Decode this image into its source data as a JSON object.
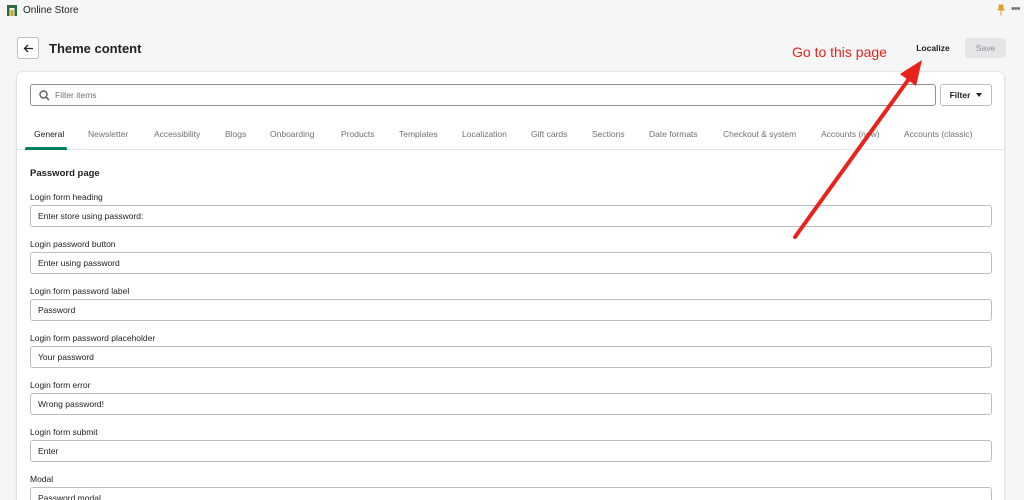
{
  "topbar": {
    "title": "Online Store"
  },
  "header": {
    "title": "Theme content",
    "localize_label": "Localize",
    "save_label": "Save"
  },
  "annotation": {
    "text": "Go to this page",
    "color": "#e8231b"
  },
  "search": {
    "placeholder": "Filter items",
    "value": ""
  },
  "filter": {
    "label": "Filter"
  },
  "tabs": [
    {
      "label": "General",
      "active": true
    },
    {
      "label": "Newsletter"
    },
    {
      "label": "Accessibility"
    },
    {
      "label": "Blogs"
    },
    {
      "label": "Onboarding"
    },
    {
      "label": "Products"
    },
    {
      "label": "Templates"
    },
    {
      "label": "Localization"
    },
    {
      "label": "Gift cards"
    },
    {
      "label": "Sections"
    },
    {
      "label": "Date formats"
    },
    {
      "label": "Checkout & system"
    },
    {
      "label": "Accounts (new)"
    },
    {
      "label": "Accounts (classic)"
    }
  ],
  "section": {
    "title": "Password page",
    "fields": [
      {
        "label": "Login form heading",
        "value": "Enter store using password:"
      },
      {
        "label": "Login password button",
        "value": "Enter using password"
      },
      {
        "label": "Login form password label",
        "value": "Password"
      },
      {
        "label": "Login form password placeholder",
        "value": "Your password"
      },
      {
        "label": "Login form error",
        "value": "Wrong password!"
      },
      {
        "label": "Login form submit",
        "value": "Enter"
      },
      {
        "label": "Modal",
        "value": "Password modal"
      }
    ]
  },
  "colors": {
    "accent": "#008060",
    "annotation": "#e8231b"
  }
}
